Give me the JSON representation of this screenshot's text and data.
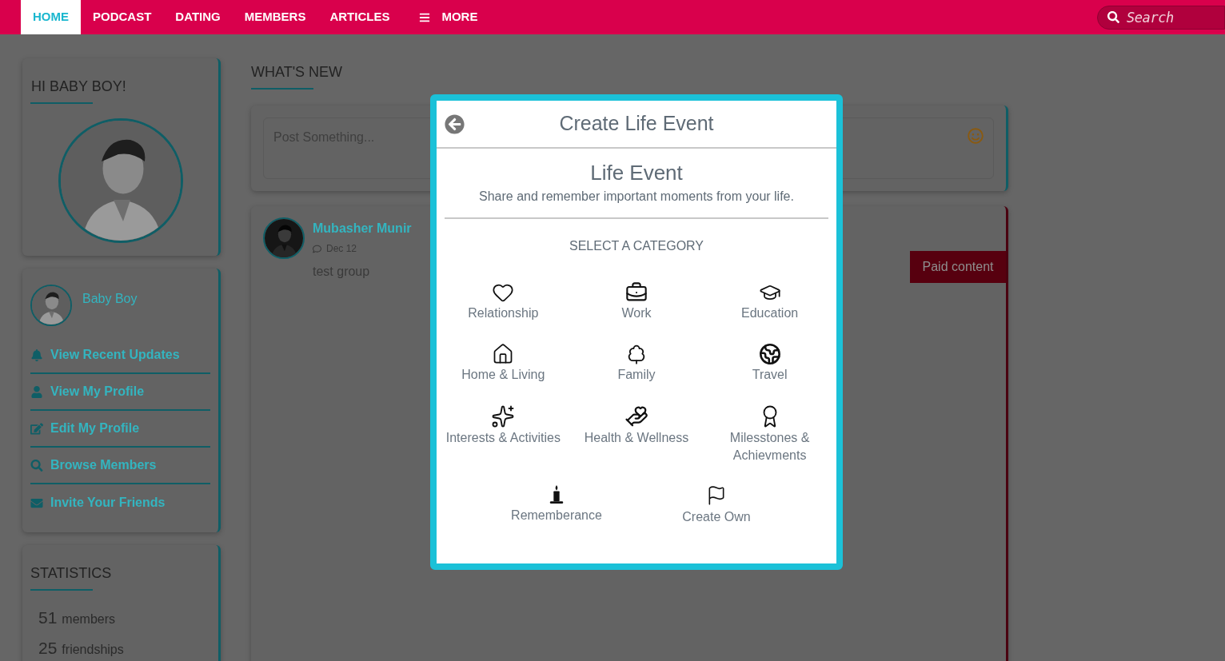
{
  "nav": {
    "items": [
      {
        "label": "HOME",
        "selected": true
      },
      {
        "label": "PODCAST",
        "selected": false
      },
      {
        "label": "DATING",
        "selected": false
      },
      {
        "label": "MEMBERS",
        "selected": false
      },
      {
        "label": "ARTICLES",
        "selected": false
      }
    ],
    "more": "MORE",
    "search": {
      "placeholder": "Search"
    }
  },
  "greeting": {
    "title": "HI BABY BOY!"
  },
  "profile": {
    "name": "Baby Boy",
    "links": [
      "View Recent Updates",
      "View My Profile",
      "Edit My Profile",
      "Browse Members",
      "Invite Your Friends"
    ]
  },
  "statistics": {
    "title": "STATISTICS",
    "rows": [
      {
        "count": "51",
        "label": "members"
      },
      {
        "count": "25",
        "label": "friendships"
      }
    ]
  },
  "feed": {
    "title": "WHAT'S NEW",
    "composer": {
      "placeholder": "Post Something..."
    },
    "post": {
      "author": "Mubasher Munir",
      "date": "Dec 12",
      "text": "test group",
      "badge": "Paid content"
    }
  },
  "modal": {
    "title": "Create Life Event",
    "heading": "Life Event",
    "subtitle": "Share and remember important moments from your life.",
    "section": "SELECT A CATEGORY",
    "category_rows": [
      [
        {
          "label": "Relationship"
        },
        {
          "label": "Work"
        },
        {
          "label": "Education"
        }
      ],
      [
        {
          "label": "Home & Living"
        },
        {
          "label": "Family"
        },
        {
          "label": "Travel"
        }
      ],
      [
        {
          "label": "Interests & Activities"
        },
        {
          "label": "Health & Wellness"
        },
        {
          "label": "Milesstones & Achievments"
        }
      ],
      [
        {
          "label": "Rememberance"
        },
        {
          "label": "Create Own"
        }
      ]
    ]
  }
}
